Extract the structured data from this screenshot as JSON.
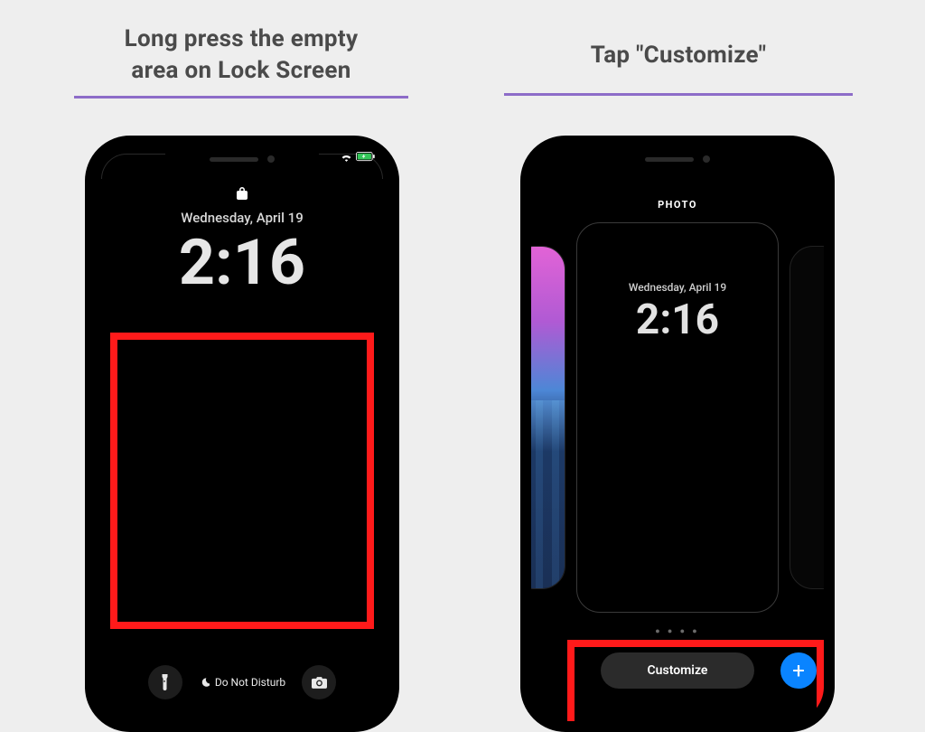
{
  "step1": {
    "title_line1": "Long press the empty",
    "title_line2": "area on Lock Screen"
  },
  "step2": {
    "title": "Tap \"Customize\""
  },
  "lockscreen": {
    "date": "Wednesday, April 19",
    "time": "2:16",
    "focus_label": "Do Not Disturb"
  },
  "gallery": {
    "heading": "PHOTO",
    "date": "Wednesday, April 19",
    "time": "2:16",
    "customize_label": "Customize",
    "pager_dots": "● ● ● ●"
  }
}
